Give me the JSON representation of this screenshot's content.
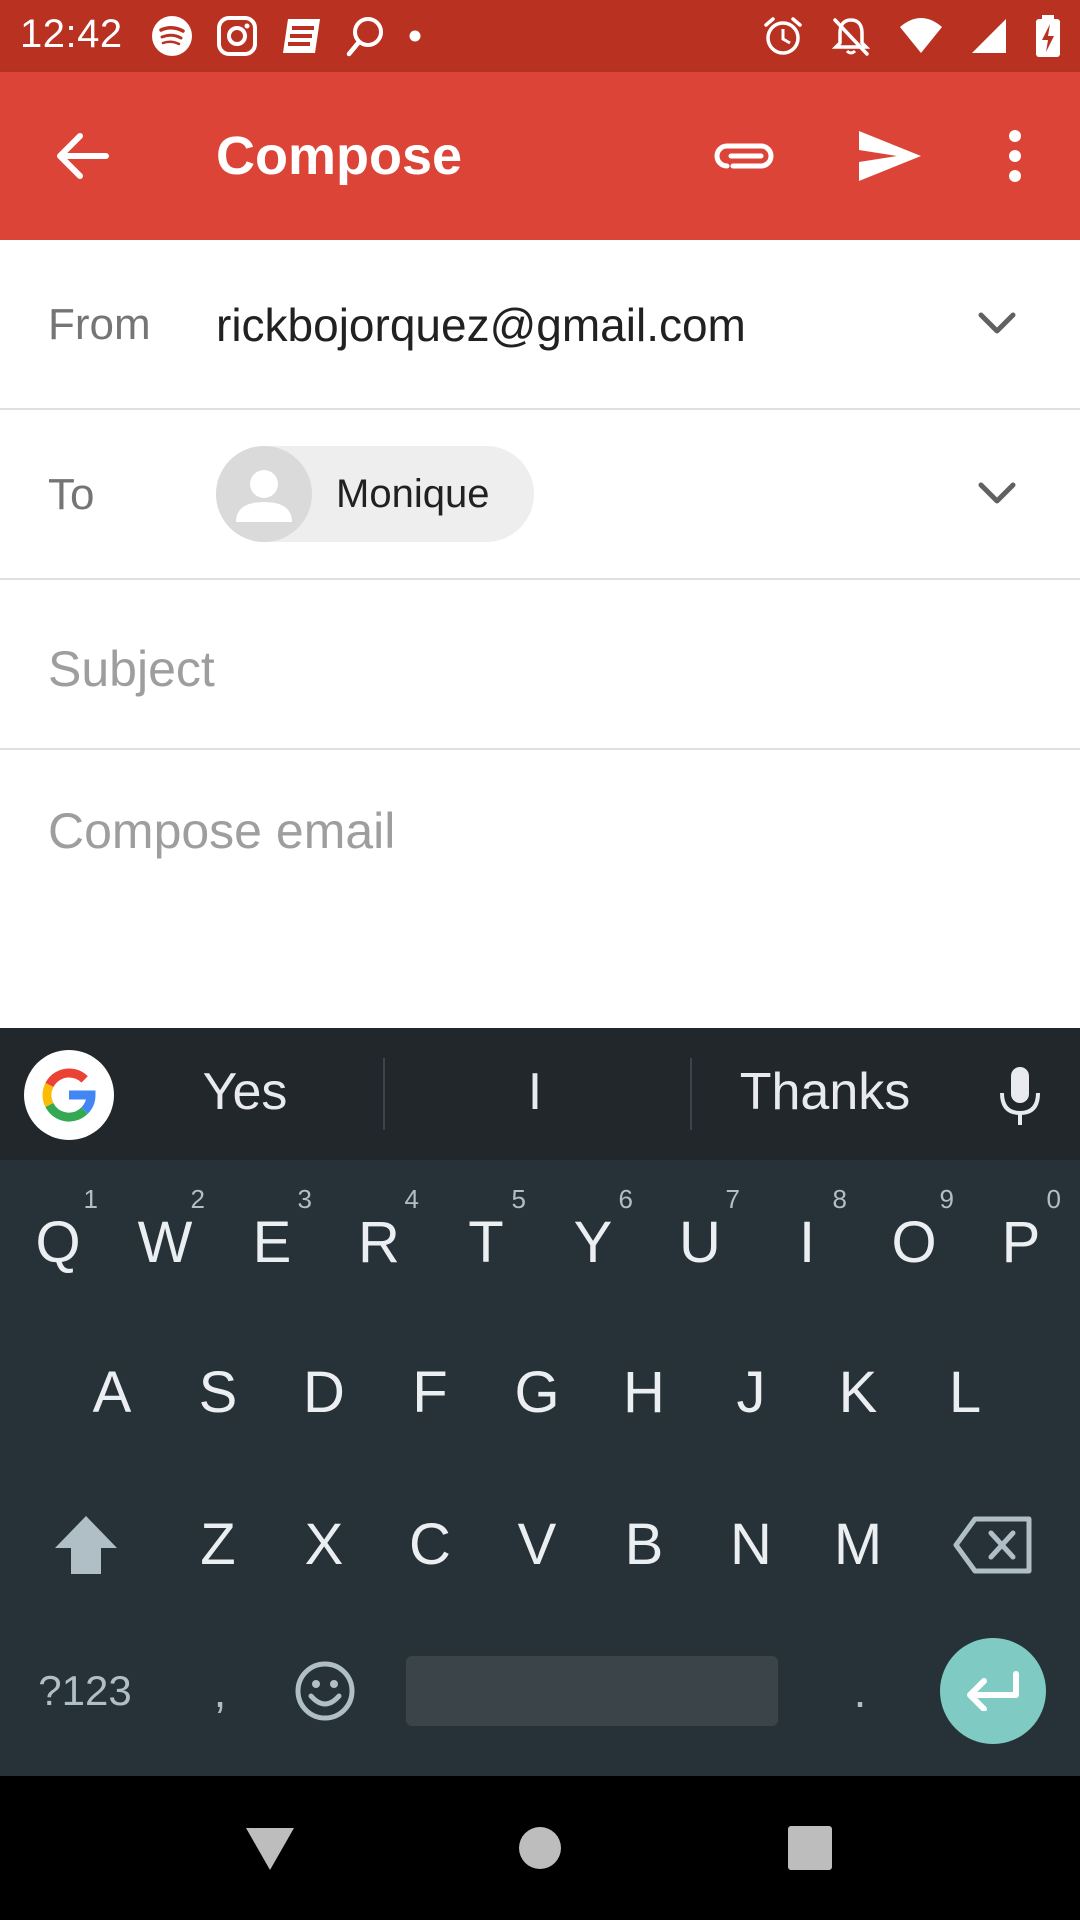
{
  "status_bar": {
    "time": "12:42",
    "left_icons": [
      "spotify-icon",
      "instagram-icon",
      "news-icon",
      "search-app-icon",
      "dot-icon"
    ],
    "right_icons": [
      "alarm-icon",
      "notifications-off-icon",
      "wifi-icon",
      "signal-icon",
      "battery-charging-icon"
    ]
  },
  "app_bar": {
    "title": "Compose",
    "accent_color": "#db4437",
    "status_color": "#b93221"
  },
  "form": {
    "from_label": "From",
    "from_value": "rickbojorquez@gmail.com",
    "to_label": "To",
    "to_recipient": "Monique",
    "subject_placeholder": "Subject",
    "body_placeholder": "Compose email"
  },
  "keyboard": {
    "suggestions": [
      "Yes",
      "I",
      "Thanks"
    ],
    "row1": [
      {
        "key": "Q",
        "hint": "1"
      },
      {
        "key": "W",
        "hint": "2"
      },
      {
        "key": "E",
        "hint": "3"
      },
      {
        "key": "R",
        "hint": "4"
      },
      {
        "key": "T",
        "hint": "5"
      },
      {
        "key": "Y",
        "hint": "6"
      },
      {
        "key": "U",
        "hint": "7"
      },
      {
        "key": "I",
        "hint": "8"
      },
      {
        "key": "O",
        "hint": "9"
      },
      {
        "key": "P",
        "hint": "0"
      }
    ],
    "row2": [
      "A",
      "S",
      "D",
      "F",
      "G",
      "H",
      "J",
      "K",
      "L"
    ],
    "row3": [
      "Z",
      "X",
      "C",
      "V",
      "B",
      "N",
      "M"
    ],
    "symbols_label": "?123",
    "comma_label": ",",
    "period_label": ".",
    "enter_color": "#7fcbc4"
  }
}
